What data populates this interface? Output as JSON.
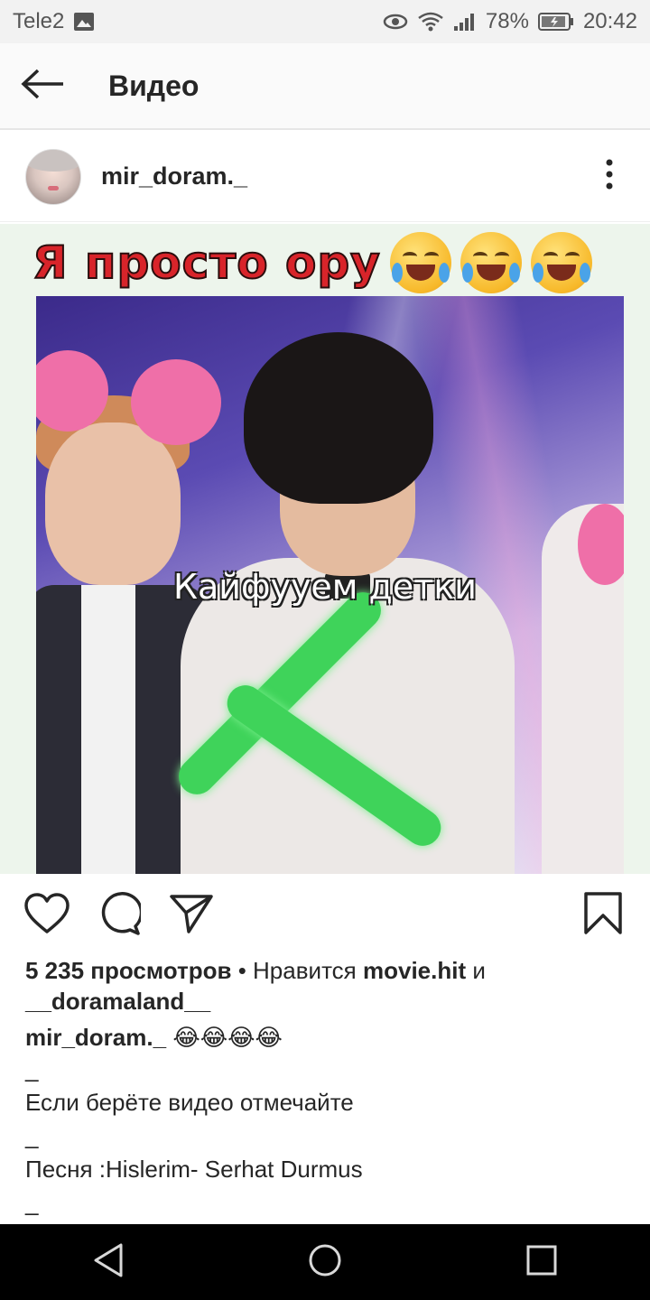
{
  "status_bar": {
    "carrier": "Tele2",
    "battery": "78%",
    "time": "20:42"
  },
  "app_bar": {
    "title": "Видео",
    "back_icon": "arrow-left-icon"
  },
  "post": {
    "username": "mir_doram._",
    "more_icon": "more-vertical-icon"
  },
  "video": {
    "top_text": "Я просто ору",
    "top_emojis": [
      "rolling-laughing-emoji",
      "rolling-laughing-emoji",
      "rolling-laughing-emoji"
    ],
    "subtitle": "Кайфууем детки"
  },
  "actions": {
    "like_icon": "heart-icon",
    "comment_icon": "comment-icon",
    "share_icon": "send-icon",
    "save_icon": "bookmark-icon"
  },
  "meta": {
    "views": "5 235 просмотров",
    "liked_by_prefix": " • Нравится ",
    "liked_by_user": "movie.hit",
    "liked_by_and": " и",
    "liked_by_user2": "__doramaland__",
    "caption_user": "mir_doram._",
    "caption_emojis": "😂😂😂😂",
    "dash1": "_",
    "line1": "Если берёте видео отмечайте",
    "dash2": "_",
    "line2": "Песня :Hislerim- Serhat Durmus",
    "dash3": "_"
  },
  "nav": {
    "back": "nav-back-icon",
    "home": "nav-home-icon",
    "recents": "nav-recents-icon"
  }
}
